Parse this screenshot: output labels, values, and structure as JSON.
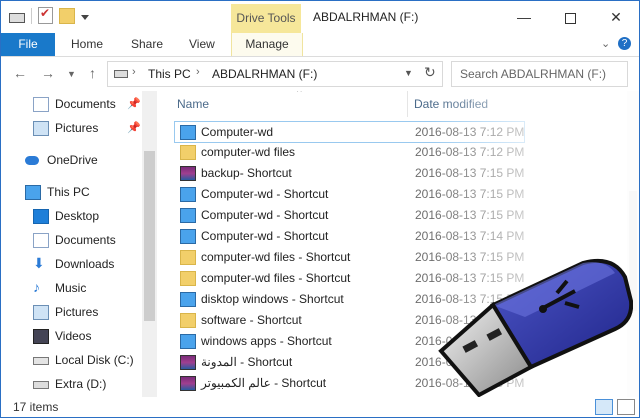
{
  "window": {
    "title": "ABDALRHMAN (F:)",
    "context_tab": "Drive Tools",
    "minimize": "—",
    "close": "✕"
  },
  "ribbon": {
    "tabs": [
      "File",
      "Home",
      "Share",
      "View",
      "Manage"
    ],
    "help": "?"
  },
  "address": {
    "crumbs": [
      "This PC",
      "ABDALRHMAN (F:)"
    ],
    "search_placeholder": "Search ABDALRHMAN (F:)"
  },
  "nav": {
    "quick": [
      {
        "label": "Documents",
        "icon": "documents-icon",
        "pinned": true
      },
      {
        "label": "Pictures",
        "icon": "pictures-icon",
        "pinned": true
      }
    ],
    "onedrive": "OneDrive",
    "thispc": "This PC",
    "pc_items": [
      {
        "label": "Desktop",
        "icon": "desktop-icon"
      },
      {
        "label": "Documents",
        "icon": "documents-icon"
      },
      {
        "label": "Downloads",
        "icon": "downloads-icon"
      },
      {
        "label": "Music",
        "icon": "music-icon"
      },
      {
        "label": "Pictures",
        "icon": "pictures-icon"
      },
      {
        "label": "Videos",
        "icon": "videos-icon"
      },
      {
        "label": "Local Disk (C:)",
        "icon": "local-disk-icon"
      },
      {
        "label": "Extra (D:)",
        "icon": "usb-drive-icon"
      }
    ]
  },
  "columns": {
    "name": "Name",
    "date": "Date modified"
  },
  "files": [
    {
      "name": "Computer-wd",
      "date": "2016-08-13 7:12 PM",
      "icon": "pc"
    },
    {
      "name": "computer-wd files",
      "date": "2016-08-13 7:12 PM",
      "icon": "folder"
    },
    {
      "name": "backup- Shortcut",
      "date": "2016-08-13 7:15 PM",
      "icon": "rar"
    },
    {
      "name": "Computer-wd - Shortcut",
      "date": "2016-08-13 7:15 PM",
      "icon": "pclnk"
    },
    {
      "name": "Computer-wd - Shortcut",
      "date": "2016-08-13 7:15 PM",
      "icon": "pclnk"
    },
    {
      "name": "Computer-wd - Shortcut",
      "date": "2016-08-13 7:14 PM",
      "icon": "pclnk"
    },
    {
      "name": "computer-wd files - Shortcut",
      "date": "2016-08-13 7:15 PM",
      "icon": "lnk"
    },
    {
      "name": "computer-wd files - Shortcut",
      "date": "2016-08-13 7:15 PM",
      "icon": "lnk"
    },
    {
      "name": "disktop windows - Shortcut",
      "date": "2016-08-13 7:15 PM",
      "icon": "pclnk"
    },
    {
      "name": "software - Shortcut",
      "date": "2016-08-13 7:15 PM",
      "icon": "lnk"
    },
    {
      "name": "windows apps - Shortcut",
      "date": "2016-08-13 7:15 PM",
      "icon": "pclnk"
    },
    {
      "name": "المدونة - Shortcut",
      "date": "2016-08-13 7:15 PM",
      "icon": "rar"
    },
    {
      "name": "عالم الكمبيوتر - Shortcut",
      "date": "2016-08-13 7:15 PM",
      "icon": "rar"
    }
  ],
  "status": {
    "count": "17 items"
  }
}
